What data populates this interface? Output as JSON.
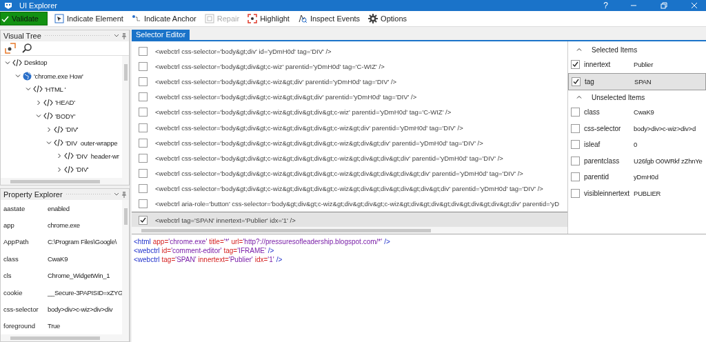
{
  "window": {
    "title": "UI Explorer",
    "help": "?"
  },
  "toolbar": [
    {
      "kind": "validate",
      "label": "Validate",
      "disabled": false
    },
    {
      "kind": "indicate-element",
      "label": "Indicate Element",
      "disabled": false
    },
    {
      "kind": "indicate-anchor",
      "label": "Indicate Anchor",
      "disabled": false
    },
    {
      "kind": "repair",
      "label": "Repair",
      "disabled": true
    },
    {
      "kind": "highlight",
      "label": "Highlight",
      "disabled": false
    },
    {
      "kind": "inspect",
      "label": "Inspect Events",
      "disabled": false
    },
    {
      "kind": "options",
      "label": "Options",
      "disabled": false
    }
  ],
  "visual_tree": {
    "title": "Visual Tree",
    "items": [
      {
        "label": "Desktop",
        "kind": "element",
        "expanded": true,
        "children": [
          {
            "label": "'chrome.exe How'",
            "kind": "app",
            "expanded": true,
            "children": [
              {
                "label": "'HTML '",
                "kind": "element",
                "expanded": true,
                "children": [
                  {
                    "label": "'HEAD'",
                    "kind": "element",
                    "expanded": false
                  },
                  {
                    "label": "'BODY'",
                    "kind": "element",
                    "expanded": true,
                    "children": [
                      {
                        "label": "'DIV'",
                        "kind": "element",
                        "expanded": false
                      },
                      {
                        "label": "'DIV  outer-wrappe",
                        "kind": "element",
                        "expanded": true,
                        "children": [
                          {
                            "label": "'DIV  header-wr",
                            "kind": "element",
                            "expanded": false
                          },
                          {
                            "label": "'DIV'",
                            "kind": "element",
                            "expanded": false
                          }
                        ]
                      }
                    ]
                  }
                ]
              }
            ]
          }
        ]
      }
    ]
  },
  "property_explorer": {
    "title": "Property Explorer",
    "rows": [
      {
        "name": "aastate",
        "value": "enabled"
      },
      {
        "name": "app",
        "value": "chrome.exe"
      },
      {
        "name": "AppPath",
        "value": "C:\\Program Files\\Google\\"
      },
      {
        "name": "class",
        "value": "CwaK9"
      },
      {
        "name": "cls",
        "value": "Chrome_WidgetWin_1"
      },
      {
        "name": "cookie",
        "value": "__Secure-3PAPISID=xZYG"
      },
      {
        "name": "css-selector",
        "value": "body>div>c-wiz>div>div"
      },
      {
        "name": "foreground",
        "value": "True"
      }
    ]
  },
  "selector_editor": {
    "tab": "Selector Editor",
    "rows": [
      {
        "text": "<webctrl css-selector='body&gt;div' id='yDmH0d' tag='DIV' />",
        "checked": false,
        "selected": false
      },
      {
        "text": "<webctrl css-selector='body&gt;div&gt;c-wiz' parentid='yDmH0d' tag='C-WIZ' />",
        "checked": false,
        "selected": false
      },
      {
        "text": "<webctrl css-selector='body&gt;div&gt;c-wiz&gt;div' parentid='yDmH0d' tag='DIV' />",
        "checked": false,
        "selected": false
      },
      {
        "text": "<webctrl css-selector='body&gt;div&gt;c-wiz&gt;div&gt;div' parentid='yDmH0d' tag='DIV' />",
        "checked": false,
        "selected": false
      },
      {
        "text": "<webctrl css-selector='body&gt;div&gt;c-wiz&gt;div&gt;div&gt;c-wiz' parentid='yDmH0d' tag='C-WIZ' />",
        "checked": false,
        "selected": false
      },
      {
        "text": "<webctrl css-selector='body&gt;div&gt;c-wiz&gt;div&gt;div&gt;c-wiz&gt;div' parentid='yDmH0d' tag='DIV' />",
        "checked": false,
        "selected": false
      },
      {
        "text": "<webctrl css-selector='body&gt;div&gt;c-wiz&gt;div&gt;div&gt;c-wiz&gt;div&gt;div' parentid='yDmH0d' tag='DIV' />",
        "checked": false,
        "selected": false
      },
      {
        "text": "<webctrl css-selector='body&gt;div&gt;c-wiz&gt;div&gt;div&gt;c-wiz&gt;div&gt;div&gt;div' parentid='yDmH0d' tag='DIV' />",
        "checked": false,
        "selected": false
      },
      {
        "text": "<webctrl css-selector='body&gt;div&gt;c-wiz&gt;div&gt;div&gt;c-wiz&gt;div&gt;div&gt;div&gt;div' parentid='yDmH0d' tag='DIV' />",
        "checked": false,
        "selected": false
      },
      {
        "text": "<webctrl css-selector='body&gt;div&gt;c-wiz&gt;div&gt;div&gt;c-wiz&gt;div&gt;div&gt;div&gt;div&gt;div' parentid='yDmH0d' tag='DIV' />",
        "checked": false,
        "selected": false
      },
      {
        "text": "<webctrl aria-role='button' css-selector='body&gt;div&gt;c-wiz&gt;div&gt;div&gt;c-wiz&gt;div&gt;div&gt;div&gt;div&gt;div&gt;div' parentid='yD",
        "checked": false,
        "selected": false
      },
      {
        "text": "<webctrl tag='SPAN' innertext='Publier' idx='1' />",
        "checked": true,
        "selected": true
      }
    ]
  },
  "attributes": {
    "groups": [
      {
        "title": "Selected Items",
        "expanded": true,
        "items": [
          {
            "name": "innertext",
            "value": "Publier",
            "checked": true,
            "selected": false
          },
          {
            "name": "tag",
            "value": "SPAN",
            "checked": true,
            "selected": true
          }
        ]
      },
      {
        "title": "Unselected Items",
        "expanded": true,
        "items": [
          {
            "name": "class",
            "value": "CwaK9",
            "checked": false,
            "selected": false
          },
          {
            "name": "css-selector",
            "value": "body>div>c-wiz>div>d",
            "checked": false,
            "selected": false
          },
          {
            "name": "isleaf",
            "value": "0",
            "checked": false,
            "selected": false
          },
          {
            "name": "parentclass",
            "value": "U26fgb O0WRkf zZhnYe",
            "checked": false,
            "selected": false
          },
          {
            "name": "parentid",
            "value": "yDmH0d",
            "checked": false,
            "selected": false
          },
          {
            "name": "visibleinnertext",
            "value": "PUBLIER",
            "checked": false,
            "selected": false
          }
        ]
      }
    ]
  },
  "xml": [
    {
      "open": "<html",
      "attrs": [
        {
          "name": "app=",
          "value": "'chrome.exe'"
        },
        {
          "name": "title=",
          "value": "'*'"
        },
        {
          "name": "url=",
          "value": "'http?://pressuresofleadership.blogspot.com/*'"
        }
      ],
      "close": "/>"
    },
    {
      "open": "<webctrl",
      "attrs": [
        {
          "name": "id=",
          "value": "'comment-editor'"
        },
        {
          "name": "tag=",
          "value": "'IFRAME'"
        }
      ],
      "close": "/>"
    },
    {
      "open": "<webctrl",
      "attrs": [
        {
          "name": "tag=",
          "value": "'SPAN'"
        },
        {
          "name": "innertext=",
          "value": "'Publier'"
        },
        {
          "name": "idx=",
          "value": "'1'"
        }
      ],
      "close": "/>"
    }
  ]
}
